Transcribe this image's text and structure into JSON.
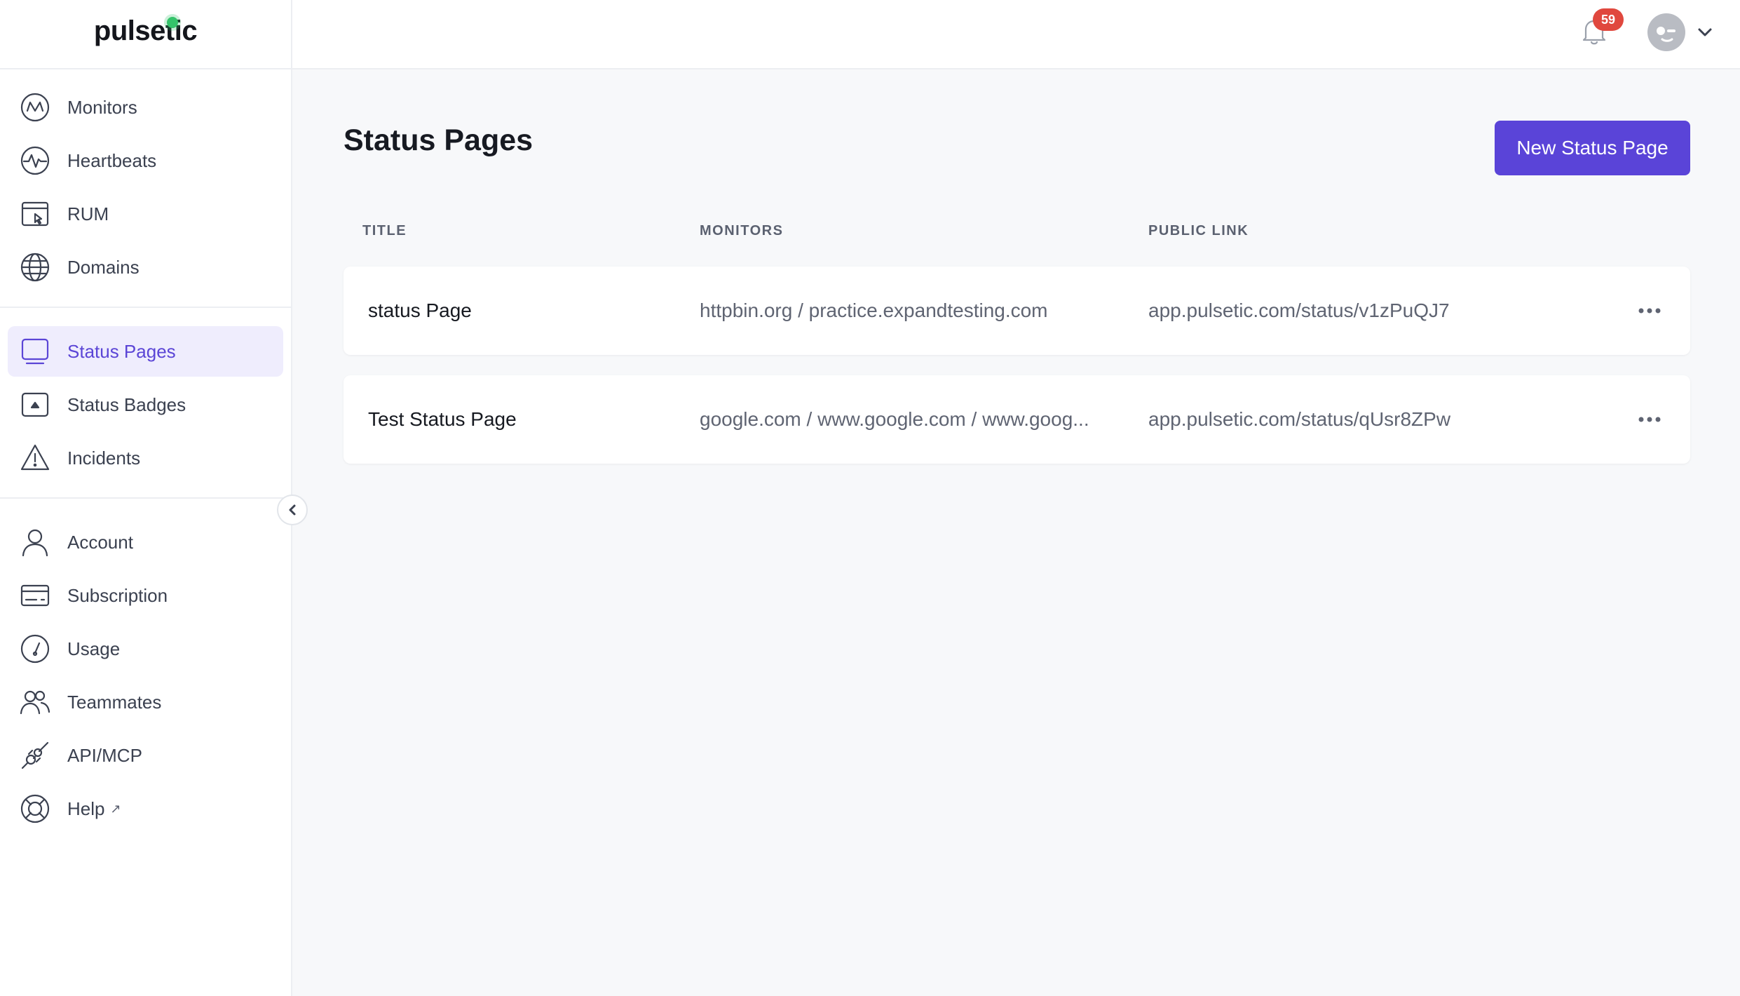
{
  "brand": {
    "name": "pulsetic",
    "accent": "#5a44d8"
  },
  "sidebar": {
    "groups": [
      {
        "items": [
          {
            "label": "Monitors",
            "icon": "monitor-wave-icon"
          },
          {
            "label": "Heartbeats",
            "icon": "heartbeat-icon"
          },
          {
            "label": "RUM",
            "icon": "browser-cursor-icon"
          },
          {
            "label": "Domains",
            "icon": "globe-icon"
          }
        ]
      },
      {
        "items": [
          {
            "label": "Status Pages",
            "icon": "screen-icon",
            "active": true
          },
          {
            "label": "Status Badges",
            "icon": "badge-icon"
          },
          {
            "label": "Incidents",
            "icon": "warning-icon"
          }
        ]
      },
      {
        "items": [
          {
            "label": "Account",
            "icon": "user-icon"
          },
          {
            "label": "Subscription",
            "icon": "card-icon"
          },
          {
            "label": "Usage",
            "icon": "gauge-icon"
          },
          {
            "label": "Teammates",
            "icon": "users-icon"
          },
          {
            "label": "API/MCP",
            "icon": "plug-icon"
          },
          {
            "label": "Help",
            "icon": "lifebuoy-icon",
            "external": true
          }
        ]
      }
    ]
  },
  "topbar": {
    "notifications_count": "59"
  },
  "main": {
    "title": "Status Pages",
    "new_button_label": "New Status Page",
    "columns": {
      "title": "TITLE",
      "monitors": "MONITORS",
      "public_link": "PUBLIC LINK"
    },
    "rows": [
      {
        "title": "status Page",
        "monitors": "httpbin.org / practice.expandtesting.com",
        "link": "app.pulsetic.com/status/v1zPuQJ7"
      },
      {
        "title": "Test Status Page",
        "monitors": "google.com / www.google.com / www.goog...",
        "link": "app.pulsetic.com/status/qUsr8ZPw"
      }
    ]
  }
}
